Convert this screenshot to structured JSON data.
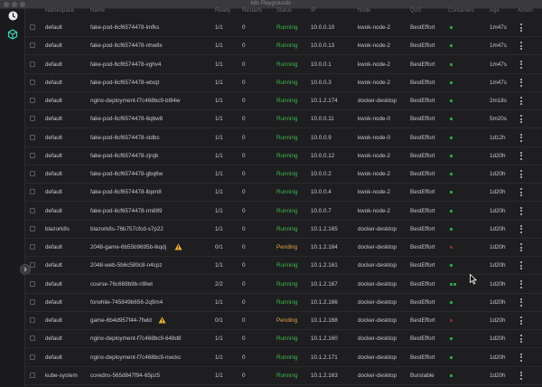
{
  "window": {
    "title": "k8s Playgrounds"
  },
  "sidebar": {
    "icons": [
      "clock-icon",
      "cube-icon"
    ]
  },
  "table": {
    "headers": [
      "Namespace",
      "Name",
      "Ready",
      "Restarts",
      "Status",
      "IP",
      "Node",
      "QoS",
      "Containers",
      "Age",
      "Action"
    ],
    "rows": [
      {
        "namespace": "default",
        "name": "fake-pod-6cf6574478-lmfks",
        "ready": "1/1",
        "restarts": "0",
        "status": "Running",
        "ip": "10.0.0.10",
        "node": "kwok-node-2",
        "qos": "BestEffort",
        "containers": 1,
        "container_state": "green",
        "age": "1m47s"
      },
      {
        "namespace": "default",
        "name": "fake-pod-6cf6574478-nhw8x",
        "ready": "1/1",
        "restarts": "0",
        "status": "Running",
        "ip": "10.0.0.13",
        "node": "kwok-node-2",
        "qos": "BestEffort",
        "containers": 1,
        "container_state": "green",
        "age": "1m47s"
      },
      {
        "namespace": "default",
        "name": "fake-pod-6cf6574478-vghv4",
        "ready": "1/1",
        "restarts": "0",
        "status": "Running",
        "ip": "10.0.0.1",
        "node": "kwok-node-2",
        "qos": "BestEffort",
        "containers": 1,
        "container_state": "green",
        "age": "1m47s"
      },
      {
        "namespace": "default",
        "name": "fake-pod-6cf6574478-wtxqt",
        "ready": "1/1",
        "restarts": "0",
        "status": "Running",
        "ip": "10.0.0.3",
        "node": "kwok-node-2",
        "qos": "BestEffort",
        "containers": 1,
        "container_state": "green",
        "age": "1m47s"
      },
      {
        "namespace": "default",
        "name": "nginx-deployment-f7c468bc9-bl94w",
        "ready": "1/1",
        "restarts": "0",
        "status": "Running",
        "ip": "10.1.2.174",
        "node": "docker-desktop",
        "qos": "BestEffort",
        "containers": 1,
        "container_state": "green",
        "age": "2m18s"
      },
      {
        "namespace": "default",
        "name": "fake-pod-6cf6574478-6qbw8",
        "ready": "1/1",
        "restarts": "0",
        "status": "Running",
        "ip": "10.0.0.11",
        "node": "kwok-node-0",
        "qos": "BestEffort",
        "containers": 1,
        "container_state": "green",
        "age": "5m20s"
      },
      {
        "namespace": "default",
        "name": "fake-pod-6cf6574478-stdbc",
        "ready": "1/1",
        "restarts": "0",
        "status": "Running",
        "ip": "10.0.0.9",
        "node": "kwok-node-0",
        "qos": "BestEffort",
        "containers": 1,
        "container_state": "green",
        "age": "1d12h"
      },
      {
        "namespace": "default",
        "name": "fake-pod-6cf6574478-zjrqb",
        "ready": "1/1",
        "restarts": "0",
        "status": "Running",
        "ip": "10.0.0.12",
        "node": "kwok-node-2",
        "qos": "BestEffort",
        "containers": 1,
        "container_state": "green",
        "age": "1d20h"
      },
      {
        "namespace": "default",
        "name": "fake-pod-6cf6574478-gbq6w",
        "ready": "1/1",
        "restarts": "0",
        "status": "Running",
        "ip": "10.0.0.2",
        "node": "kwok-node-2",
        "qos": "BestEffort",
        "containers": 1,
        "container_state": "green",
        "age": "1d20h"
      },
      {
        "namespace": "default",
        "name": "fake-pod-6cf6574478-lbpm8",
        "ready": "1/1",
        "restarts": "0",
        "status": "Running",
        "ip": "10.0.0.4",
        "node": "kwok-node-2",
        "qos": "BestEffort",
        "containers": 1,
        "container_state": "green",
        "age": "1d20h"
      },
      {
        "namespace": "default",
        "name": "fake-pod-6cf6574478-rm889",
        "ready": "1/1",
        "restarts": "0",
        "status": "Running",
        "ip": "10.0.0.7",
        "node": "kwok-node-2",
        "qos": "BestEffort",
        "containers": 1,
        "container_state": "green",
        "age": "1d20h"
      },
      {
        "namespace": "blazork8s",
        "name": "blazork8s-76b757cfcd-s7p22",
        "ready": "1/1",
        "restarts": "0",
        "status": "Running",
        "ip": "10.1.2.165",
        "node": "docker-desktop",
        "qos": "BestEffort",
        "containers": 1,
        "container_state": "green",
        "age": "1d20h"
      },
      {
        "namespace": "default",
        "name": "2048-game-6b55b9695b-lkqdj",
        "warning": true,
        "ready": "0/1",
        "restarts": "0",
        "status": "Pending",
        "ip": "10.1.2.164",
        "node": "docker-desktop",
        "qos": "BestEffort",
        "containers": 1,
        "container_state": "red",
        "age": "1d20h"
      },
      {
        "namespace": "default",
        "name": "2048-web-5b6c589c8-n4cpz",
        "ready": "1/1",
        "restarts": "0",
        "status": "Running",
        "ip": "10.1.2.161",
        "node": "docker-desktop",
        "qos": "BestEffort",
        "containers": 1,
        "container_state": "green",
        "age": "1d20h"
      },
      {
        "namespace": "default",
        "name": "course-76c669b9b-n9lwt",
        "ready": "2/2",
        "restarts": "0",
        "status": "Running",
        "ip": "10.1.2.167",
        "node": "docker-desktop",
        "qos": "BestEffort",
        "containers": 2,
        "container_state": "green",
        "age": "1d20h"
      },
      {
        "namespace": "default",
        "name": "forwhile-745849b656-2q9m4",
        "ready": "1/1",
        "restarts": "0",
        "status": "Running",
        "ip": "10.1.2.166",
        "node": "docker-desktop",
        "qos": "BestEffort",
        "containers": 1,
        "container_state": "green",
        "age": "1d20h"
      },
      {
        "namespace": "default",
        "name": "game-6b4d957f44-7fwld",
        "warning": true,
        "ready": "0/1",
        "restarts": "0",
        "status": "Pending",
        "ip": "10.1.2.168",
        "node": "docker-desktop",
        "qos": "BestEffort",
        "containers": 1,
        "container_state": "red",
        "age": "1d20h"
      },
      {
        "namespace": "default",
        "name": "nginx-deployment-f7c468bc9-648d8",
        "ready": "1/1",
        "restarts": "0",
        "status": "Running",
        "ip": "10.1.2.160",
        "node": "docker-desktop",
        "qos": "BestEffort",
        "containers": 1,
        "container_state": "green",
        "age": "1d20h"
      },
      {
        "namespace": "default",
        "name": "nginx-deployment-f7c468bc9-nwckc",
        "ready": "1/1",
        "restarts": "0",
        "status": "Running",
        "ip": "10.1.2.171",
        "node": "docker-desktop",
        "qos": "BestEffort",
        "containers": 1,
        "container_state": "green",
        "age": "1d20h"
      },
      {
        "namespace": "kube-system",
        "name": "coredns-565d847f94-65pz5",
        "ready": "1/1",
        "restarts": "0",
        "status": "Running",
        "ip": "10.1.2.163",
        "node": "docker-desktop",
        "qos": "Burstable",
        "containers": 1,
        "container_state": "green",
        "age": "1d20h"
      }
    ]
  },
  "colors": {
    "running": "#3fb950",
    "pending": "#e3a344",
    "container_ok": "#2ea043",
    "container_err": "#8b2a2a",
    "warning": "#f0b43c"
  }
}
